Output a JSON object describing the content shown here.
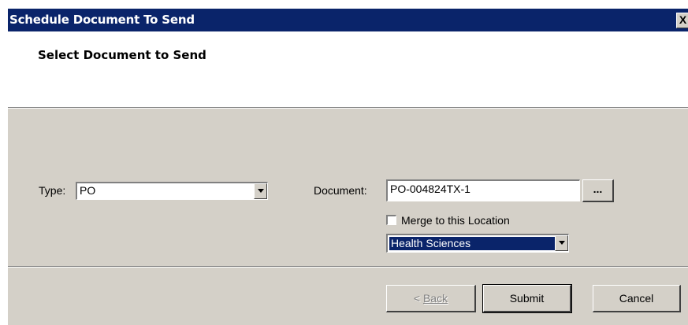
{
  "window": {
    "title": "Schedule Document To Send",
    "close_glyph": "X"
  },
  "header": {
    "title": "Select Document to Send"
  },
  "form": {
    "type_label": "Type:",
    "type_value": "PO",
    "document_label": "Document:",
    "document_value": "PO-004824TX-1",
    "browse_label": "...",
    "merge_label": "Merge to this Location",
    "merge_checked": false,
    "location_value": "Health Sciences"
  },
  "buttons": {
    "back": "Back",
    "submit": "Submit",
    "cancel": "Cancel"
  },
  "icons": {
    "close": "close-icon",
    "dropdown": "chevron-down-icon"
  },
  "colors": {
    "titlebar": "#0a246a",
    "dialog": "#d4d0c8",
    "selection": "#0a246a"
  }
}
